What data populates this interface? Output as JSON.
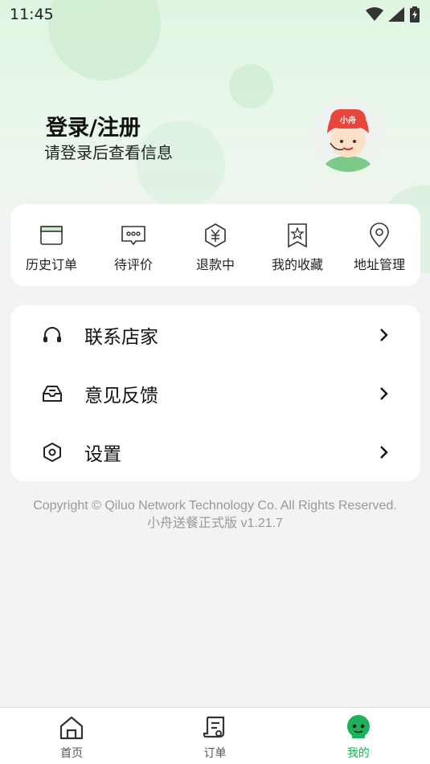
{
  "status_bar": {
    "time": "11:45"
  },
  "profile": {
    "login_title": "登录/注册",
    "login_subtitle": "请登录后查看信息",
    "avatar_text": "小舟"
  },
  "quick_actions": [
    {
      "label": "历史订单",
      "icon": "box-icon"
    },
    {
      "label": "待评价",
      "icon": "comment-icon"
    },
    {
      "label": "退款中",
      "icon": "yen-icon"
    },
    {
      "label": "我的收藏",
      "icon": "star-bookmark-icon"
    },
    {
      "label": "地址管理",
      "icon": "location-pin-icon"
    }
  ],
  "menu": [
    {
      "label": "联系店家",
      "icon": "headphones-icon"
    },
    {
      "label": "意见反馈",
      "icon": "inbox-icon"
    },
    {
      "label": "设置",
      "icon": "settings-hex-icon"
    }
  ],
  "footer": {
    "copyright": "Copyright © Qiluo Network Technology Co. All Rights Reserved.",
    "version": "小舟送餐正式版 v1.21.7"
  },
  "tabs": [
    {
      "label": "首页",
      "icon": "home-icon"
    },
    {
      "label": "订单",
      "icon": "receipt-icon"
    },
    {
      "label": "我的",
      "icon": "profile-icon"
    }
  ],
  "colors": {
    "accent": "#1db25a",
    "hero_bg": "#dff5e2",
    "page_bg": "#f3f3f3"
  }
}
